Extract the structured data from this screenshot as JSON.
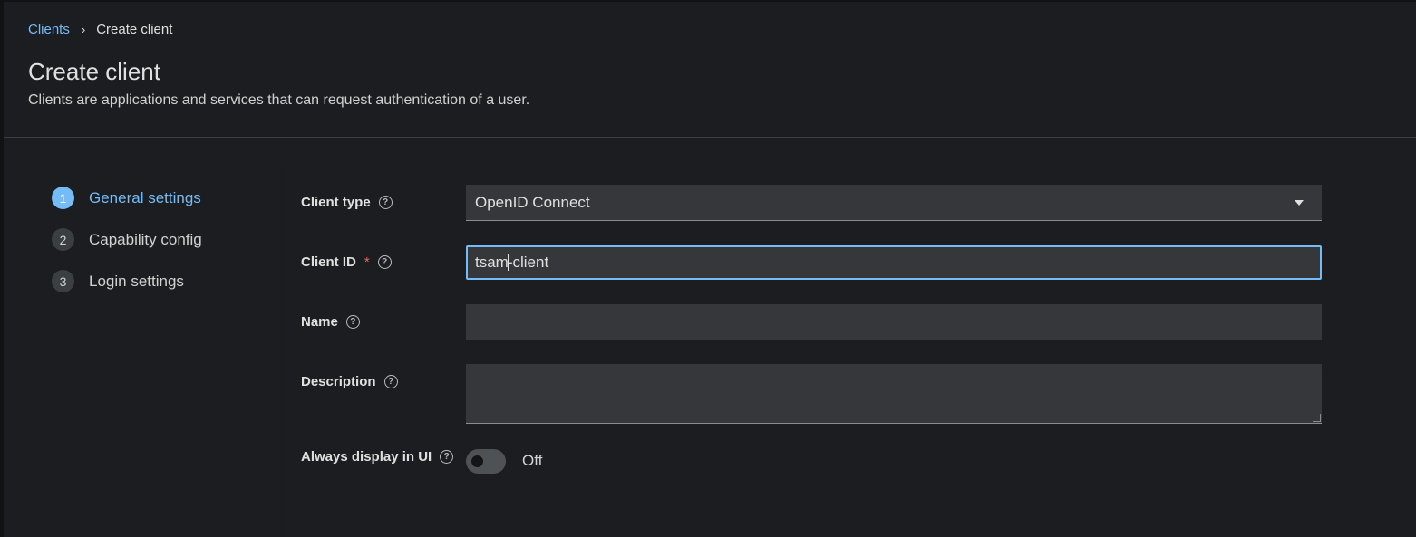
{
  "breadcrumb": {
    "parent": "Clients",
    "separator": "›",
    "current": "Create client"
  },
  "header": {
    "title": "Create client",
    "description": "Clients are applications and services that can request authentication of a user."
  },
  "wizard": {
    "steps": [
      {
        "number": "1",
        "label": "General settings",
        "active": true
      },
      {
        "number": "2",
        "label": "Capability config",
        "active": false
      },
      {
        "number": "3",
        "label": "Login settings",
        "active": false
      }
    ]
  },
  "form": {
    "client_type": {
      "label": "Client type",
      "value": "OpenID Connect"
    },
    "client_id": {
      "label": "Client ID",
      "required_mark": "*",
      "value_before_cursor": "tsam",
      "value_after_cursor": "-client"
    },
    "name": {
      "label": "Name",
      "value": ""
    },
    "description": {
      "label": "Description",
      "value": ""
    },
    "always_display": {
      "label": "Always display in UI",
      "state": "Off"
    }
  },
  "icons": {
    "help": "?"
  },
  "colors": {
    "accent": "#73bcf7",
    "required": "#f0625c",
    "background": "#1b1d21",
    "input_bg": "#36373b"
  }
}
